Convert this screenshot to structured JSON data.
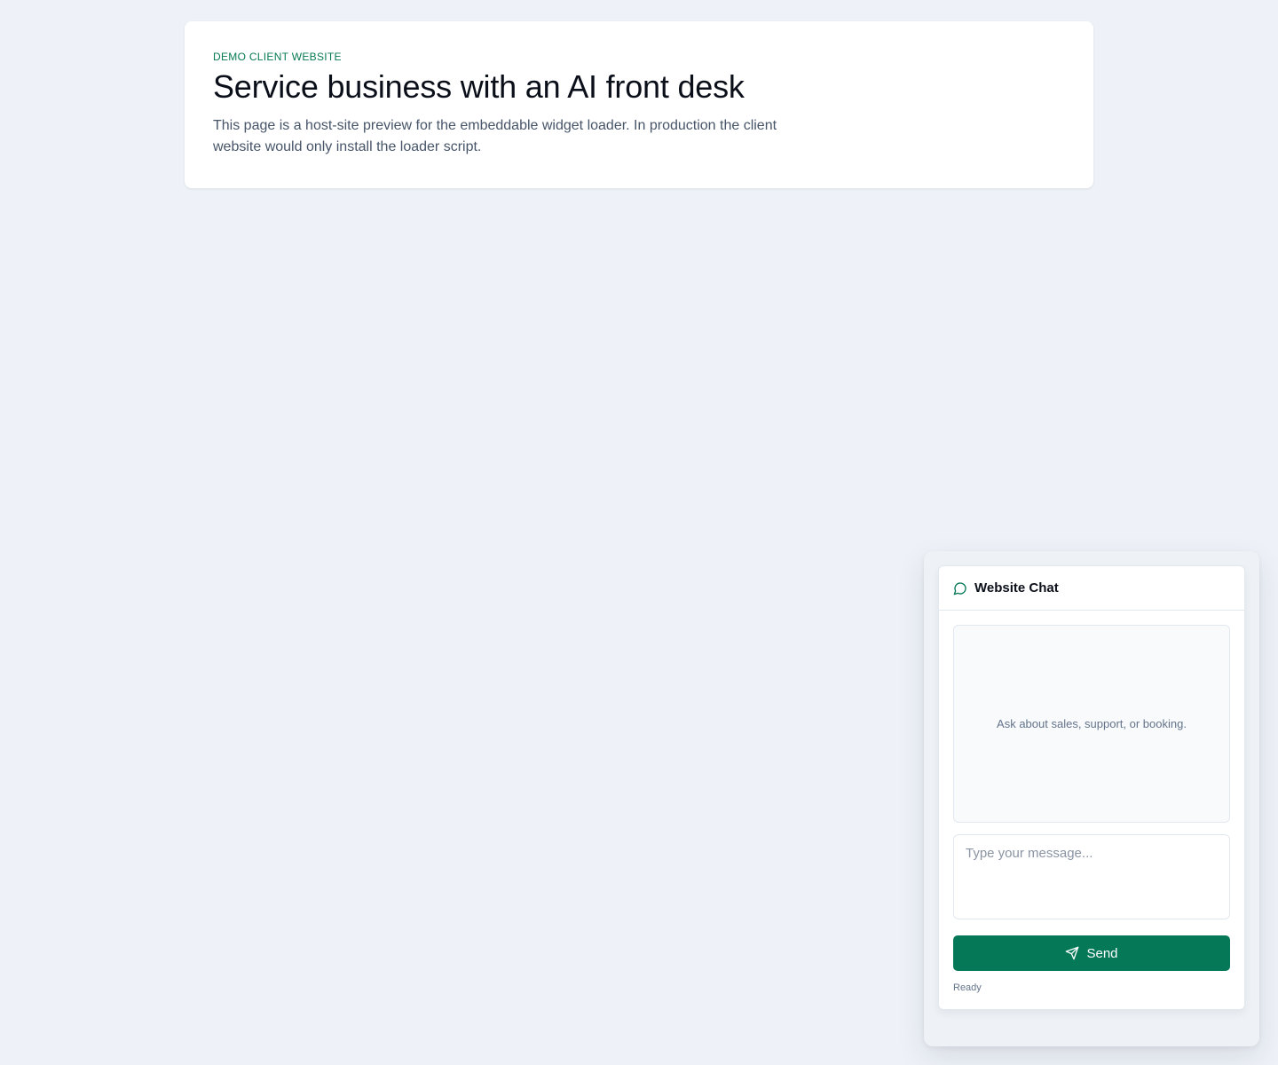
{
  "hero": {
    "eyebrow": "DEMO CLIENT WEBSITE",
    "title": "Service business with an AI front desk",
    "description": "This page is a host-site preview for the embeddable widget loader. In production the client website would only install the loader script."
  },
  "widget": {
    "title": "Website Chat",
    "header_icon": "chat-bubble-icon",
    "empty_state": "Ask about sales, support, or booking.",
    "input": {
      "value": "",
      "placeholder": "Type your message..."
    },
    "send_label": "Send",
    "send_icon": "send-icon",
    "status": "Ready"
  },
  "colors": {
    "accent": "#047857",
    "eyebrow": "#067a52",
    "background": "#eef2f8"
  }
}
